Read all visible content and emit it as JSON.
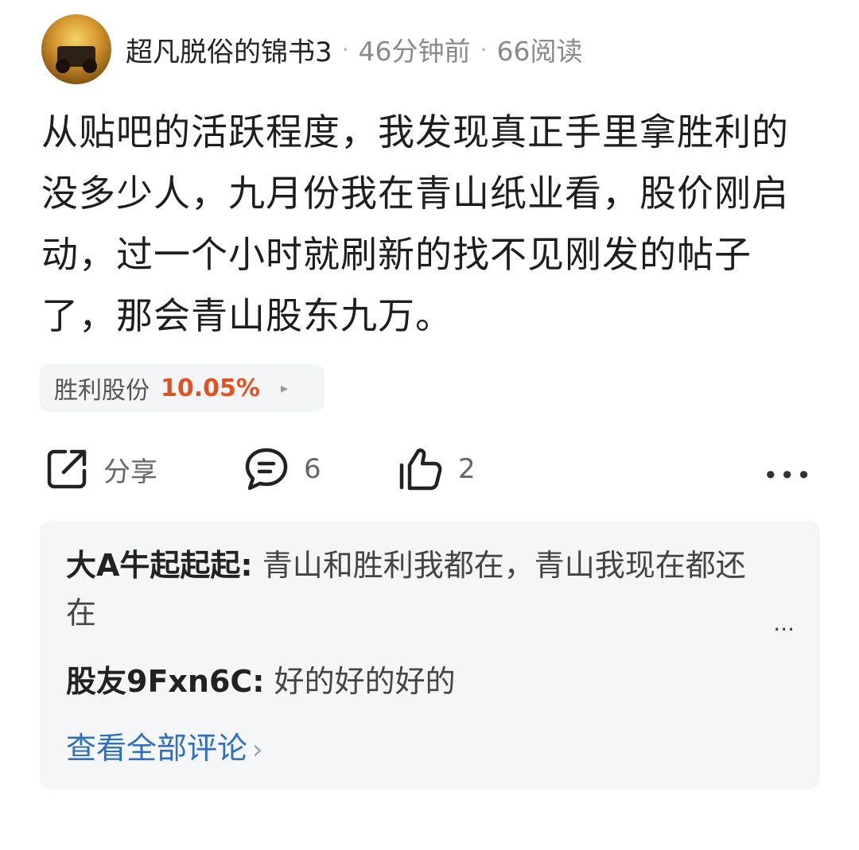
{
  "post": {
    "author": "超凡脱俗的锦书3",
    "time": "46分钟前",
    "reads": "66阅读",
    "separator": "·",
    "body": "从贴吧的活跃程度，我发现真正手里拿胜利的没多少人，九月份我在青山纸业看，股价刚启动，过一个小时就刷新的找不见刚发的帖子了，那会青山股东九万。",
    "stock": {
      "name": "胜利股份",
      "change": "10.05%",
      "arrow": "▸",
      "color": "#e05320"
    }
  },
  "actions": {
    "share_label": "分享",
    "comment_count": "6",
    "like_count": "2",
    "more": "•••"
  },
  "comments": {
    "items": [
      {
        "user": "大A牛起起起",
        "sep": ":",
        "text": "青山和胜利我都在，青山我现在都还在"
      },
      {
        "user": "股友9Fxn6C",
        "sep": ":",
        "text": "好的好的好的"
      }
    ],
    "more": "...",
    "view_all": "查看全部评论",
    "view_all_chevron": "›"
  },
  "colors": {
    "accent_link": "#2f6fc0",
    "positive": "#e05320"
  }
}
